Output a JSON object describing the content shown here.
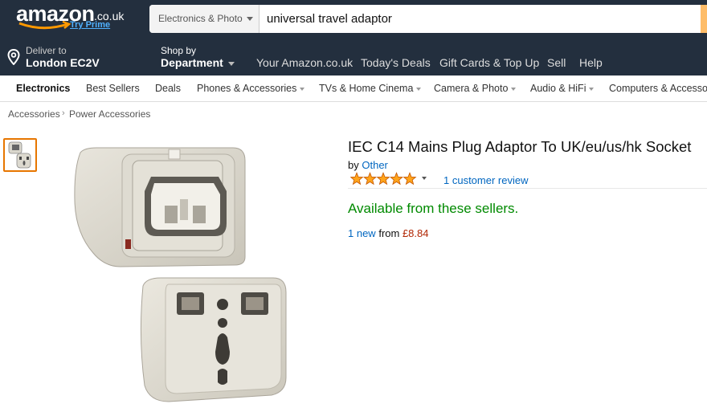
{
  "header": {
    "logo_word": "amazon",
    "logo_tld": ".co.uk",
    "logo_prime": "Try Prime",
    "search_category": "Electronics & Photo",
    "search_value": "universal travel adaptor"
  },
  "nav": {
    "deliver_small": "Deliver to",
    "deliver_big": "London EC2V",
    "shop_small": "Shop by",
    "shop_big": "Department",
    "links": [
      "Your Amazon.co.uk",
      "Today's Deals",
      "Gift Cards & Top Up",
      "Sell",
      "Help"
    ]
  },
  "subnav": {
    "items": [
      "Electronics",
      "Best Sellers",
      "Deals",
      "Phones & Accessories",
      "TVs & Home Cinema",
      "Camera & Photo",
      "Audio & HiFi",
      "Computers & Accessories"
    ]
  },
  "breadcrumb": [
    "Accessories",
    "Power Accessories"
  ],
  "product": {
    "title": "IEC C14 Mains Plug Adaptor To UK/eu/us/hk Socket",
    "by_label": "by",
    "brand": "Other",
    "rating_stars": 5,
    "reviews": "1 customer review",
    "availability": "Available from these sellers.",
    "offer_new": "1 new",
    "offer_from": "from",
    "offer_price": "£8.84"
  },
  "colors": {
    "header_bg": "#232f3e",
    "link": "#0066c0",
    "available": "#008a00",
    "price": "#b12704",
    "star": "#ffa41c"
  }
}
